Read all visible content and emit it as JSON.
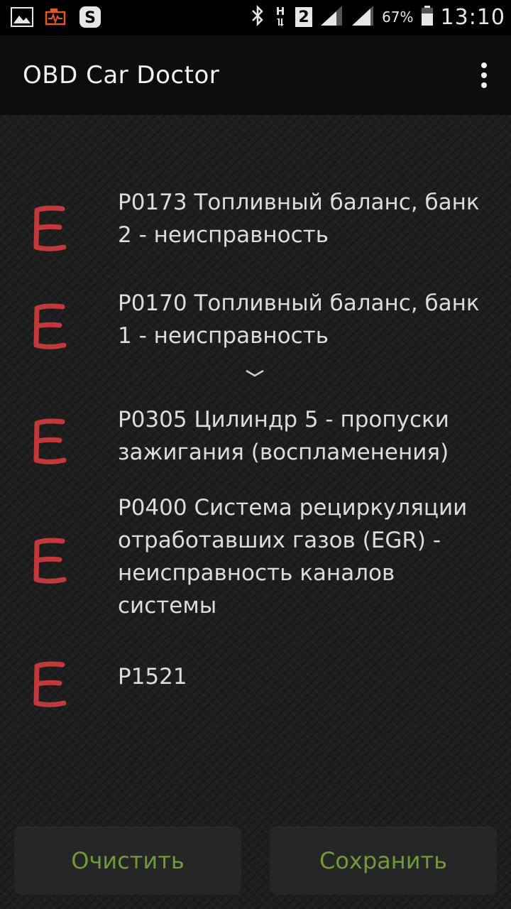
{
  "status_bar": {
    "left_icons": [
      "gallery-icon",
      "car-engine-icon",
      "skype-icon"
    ],
    "right_icons": [
      "bluetooth-icon",
      "network-h-icon",
      "sim-2-icon",
      "signal-icon",
      "signal-icon-2",
      "battery-icon"
    ],
    "sim_label": "2",
    "battery_percent": "67%",
    "time": "13:10"
  },
  "app_bar": {
    "title": "OBD Car Doctor",
    "menu_icon": "overflow-menu-icon"
  },
  "errors": [
    {
      "badge": "E",
      "text": "P0173 Топливный баланс, банк 2 - неисправность"
    },
    {
      "badge": "E",
      "text": "P0170 Топливный баланс, банк 1 - неисправность"
    },
    {
      "badge": "E",
      "text": "P0305 Цилиндр 5 - пропуски зажигания (воспламенения)"
    },
    {
      "badge": "E",
      "text": "P0400 Система рециркуляции отработавших газов (EGR) - неисправность каналов системы"
    },
    {
      "badge": "E",
      "text": "P1521"
    }
  ],
  "buttons": {
    "clear_label": "Очистить",
    "save_label": "Сохранить"
  },
  "colors": {
    "badge": "#c0393b",
    "button_text": "#6f9a3b",
    "background": "#1e1e1e"
  }
}
